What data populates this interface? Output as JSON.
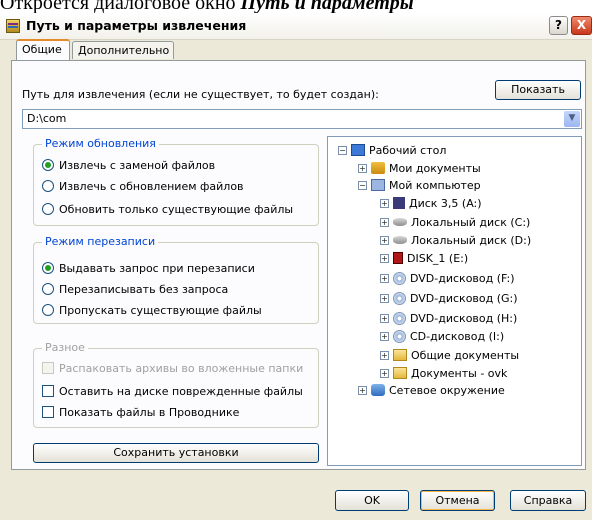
{
  "page_caption": {
    "prefix": "Откроется диалоговое окно ",
    "italic": "Путь и параметры"
  },
  "window": {
    "title": "Путь и параметры извлечения",
    "help_btn": "?",
    "close_btn": "X"
  },
  "tabs": [
    {
      "label": "Общие",
      "active": true
    },
    {
      "label": "Дополнительно",
      "active": false
    }
  ],
  "path": {
    "label": "Путь для извлечения (если не существует, то будет создан):",
    "show_button": "Показать",
    "value": "D:\\com"
  },
  "update_mode": {
    "title": "Режим обновления",
    "options": [
      {
        "label": "Извлечь с заменой файлов",
        "selected": true
      },
      {
        "label": "Извлечь с обновлением файлов",
        "selected": false
      },
      {
        "label": "Обновить только существующие файлы",
        "selected": false
      }
    ]
  },
  "overwrite_mode": {
    "title": "Режим перезаписи",
    "options": [
      {
        "label": "Выдавать запрос при перезаписи",
        "selected": true
      },
      {
        "label": "Перезаписывать без запроса",
        "selected": false
      },
      {
        "label": "Пропускать существующие файлы",
        "selected": false
      }
    ]
  },
  "misc": {
    "title": "Разное",
    "options": [
      {
        "label": "Распаковать архивы во вложенные папки",
        "checked": false,
        "disabled": true
      },
      {
        "label": "Оставить на диске поврежденные файлы",
        "checked": false,
        "disabled": false
      },
      {
        "label": "Показать файлы в Проводнике",
        "checked": false,
        "disabled": false
      }
    ]
  },
  "save_button": "Сохранить установки",
  "tree": [
    {
      "label": "Рабочий стол",
      "icon": "desktop-icon",
      "expander": "−"
    },
    {
      "label": "Мои документы",
      "icon": "documents-folder-icon",
      "expander": "+"
    },
    {
      "label": "Мой компьютер",
      "icon": "computer-icon",
      "expander": "−"
    },
    {
      "label": "Диск 3,5 (A:)",
      "icon": "floppy-drive-icon",
      "expander": "+"
    },
    {
      "label": "Локальный диск (C:)",
      "icon": "hard-disk-icon",
      "expander": "+"
    },
    {
      "label": "Локальный диск (D:)",
      "icon": "hard-disk-icon",
      "expander": "+"
    },
    {
      "label": "DISK_1 (E:)",
      "icon": "usb-drive-icon",
      "expander": "+"
    },
    {
      "label": "DVD-дисковод (F:)",
      "icon": "dvd-drive-icon",
      "expander": "+"
    },
    {
      "label": "DVD-дисковод (G:)",
      "icon": "dvd-drive-icon",
      "expander": "+"
    },
    {
      "label": "DVD-дисковод (H:)",
      "icon": "dvd-drive-icon",
      "expander": "+"
    },
    {
      "label": "CD-дисковод (I:)",
      "icon": "cd-drive-icon",
      "expander": "+"
    },
    {
      "label": "Общие документы",
      "icon": "folder-icon",
      "expander": "+"
    },
    {
      "label": "Документы - ovk",
      "icon": "folder-icon",
      "expander": "+"
    },
    {
      "label": "Сетевое окружение",
      "icon": "network-icon",
      "expander": "+"
    }
  ],
  "footer": {
    "ok": "OK",
    "cancel": "Отмена",
    "help": "Справка"
  }
}
